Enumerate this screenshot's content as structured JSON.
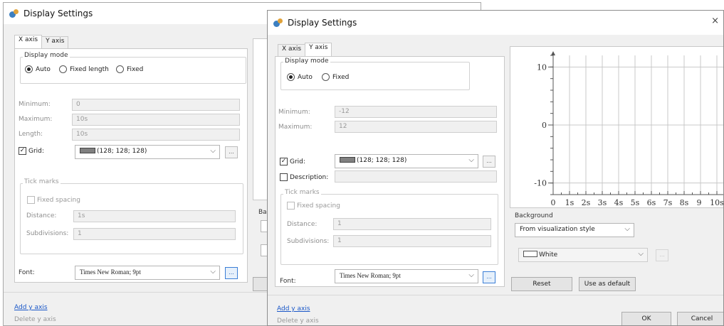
{
  "back_window": {
    "title": "Display Settings",
    "tabs": [
      "X axis",
      "Y axis"
    ],
    "display_mode_label": "Display mode",
    "modes": [
      "Auto",
      "Fixed length",
      "Fixed"
    ],
    "minimum_label": "Minimum:",
    "minimum_value": "0",
    "maximum_label": "Maximum:",
    "maximum_value": "10s",
    "length_label": "Length:",
    "length_value": "10s",
    "grid_label": "Grid:",
    "grid_value": "(128; 128; 128)",
    "tick_marks_label": "Tick marks",
    "fixed_spacing_label": "Fixed spacing",
    "distance_label": "Distance:",
    "distance_value": "1s",
    "subdivisions_label": "Subdivisions:",
    "subdivisions_value": "1",
    "font_label": "Font:",
    "font_value": "Times New Roman; 9pt",
    "add_y_axis": "Add y axis",
    "delete_y_axis": "Delete y axis",
    "partial_label": "Ba",
    "dots": "..."
  },
  "front_window": {
    "title": "Display Settings",
    "close": "×",
    "tabs": [
      "X axis",
      "Y axis"
    ],
    "display_mode_label": "Display mode",
    "modes": [
      "Auto",
      "Fixed"
    ],
    "minimum_label": "Minimum:",
    "minimum_value": "-12",
    "maximum_label": "Maximum:",
    "maximum_value": "12",
    "grid_label": "Grid:",
    "grid_value": "(128; 128; 128)",
    "description_label": "Description:",
    "tick_marks_label": "Tick marks",
    "fixed_spacing_label": "Fixed spacing",
    "distance_label": "Distance:",
    "distance_value": "1",
    "subdivisions_label": "Subdivisions:",
    "subdivisions_value": "1",
    "font_label": "Font:",
    "font_value": "Times New Roman; 9pt",
    "background_label": "Background",
    "background_source": "From visualization style",
    "background_color": "White",
    "reset_button": "Reset",
    "use_default_button": "Use as default",
    "ok_button": "OK",
    "cancel_button": "Cancel",
    "add_y_axis": "Add y axis",
    "delete_y_axis": "Delete y axis",
    "dots": "..."
  },
  "preview": {
    "y_ticks": [
      "10",
      "0",
      "-10"
    ],
    "x_ticks": [
      "0",
      "1s",
      "2s",
      "3s",
      "4s",
      "5s",
      "6s",
      "7s",
      "8s",
      "9",
      "10s"
    ]
  },
  "colors": {
    "grid": "#808080",
    "accent": "#1a57c8"
  }
}
